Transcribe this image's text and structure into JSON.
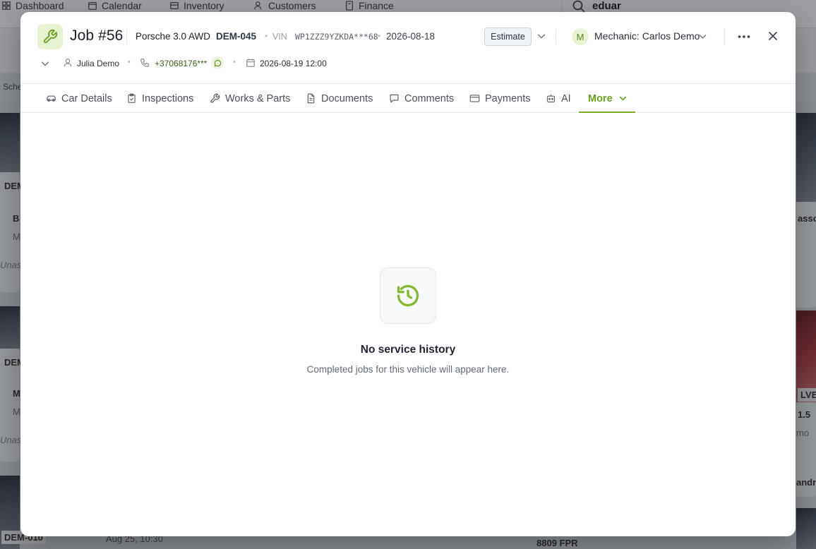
{
  "background": {
    "nav": [
      {
        "label": "Dashboard",
        "icon": "dashboard-icon"
      },
      {
        "label": "Calendar",
        "icon": "calendar-icon"
      },
      {
        "label": "Inventory",
        "icon": "inventory-icon"
      },
      {
        "label": "Customers",
        "icon": "customers-icon"
      },
      {
        "label": "Finance",
        "icon": "finance-icon"
      }
    ],
    "search_value": "eduar",
    "sub_label": "Sche",
    "card_texts": [
      "DEM",
      "B",
      "M",
      "Unas",
      "DEM",
      "M",
      "M",
      "Unas",
      "DEM-010",
      "Aug 25, 10:30",
      "asso",
      "1.5",
      "mo",
      "andr",
      "LVE",
      "8809 FPR"
    ]
  },
  "job": {
    "title": "Job #56",
    "car_model": "Porsche 3.0 AWD",
    "plate": "DEM-045",
    "vin_label": "VIN",
    "vin": "WP1ZZZ9YZKDA***68",
    "date": "2026-08-18",
    "status": "Estimate",
    "mechanic_initial": "M",
    "mechanic": "Mechanic: Carlos Demo",
    "customer": "Julia Demo",
    "phone": "+37068176***",
    "appointment": "2026-08-19 12:00"
  },
  "tabs": [
    {
      "label": "Car Details",
      "icon": "car-icon"
    },
    {
      "label": "Inspections",
      "icon": "clipboard-icon"
    },
    {
      "label": "Works & Parts",
      "icon": "wrench-icon"
    },
    {
      "label": "Documents",
      "icon": "document-icon"
    },
    {
      "label": "Comments",
      "icon": "comment-icon"
    },
    {
      "label": "Payments",
      "icon": "card-icon"
    },
    {
      "label": "AI",
      "icon": "robot-icon"
    },
    {
      "label": "More",
      "icon": "chevron-down-icon",
      "active": true
    }
  ],
  "empty_state": {
    "icon": "history-icon",
    "title": "No service history",
    "description": "Completed jobs for this vehicle will appear here."
  },
  "colors": {
    "accent": "#7aad2b",
    "accent_dark": "#6d9e24",
    "text": "#1f2430",
    "muted": "#636a74"
  }
}
